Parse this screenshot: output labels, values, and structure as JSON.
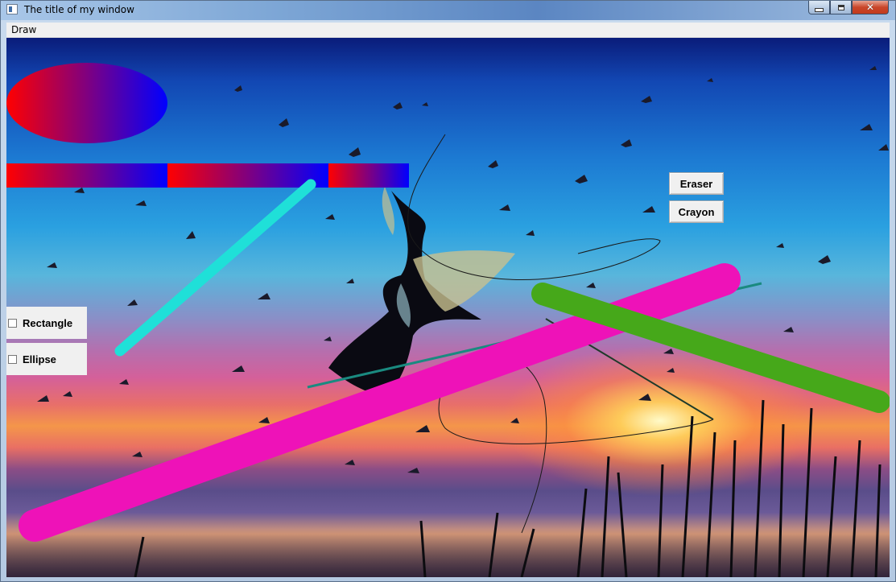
{
  "window": {
    "title": "The title of my window",
    "controls": {
      "minimize": "minimize",
      "maximize": "maximize",
      "close": "✕"
    }
  },
  "menu": {
    "items": [
      "Draw"
    ]
  },
  "toolbar": {
    "eraser_label": "Eraser",
    "crayon_label": "Crayon"
  },
  "shapes": {
    "rectangle_label": "Rectangle",
    "ellipse_label": "Ellipse",
    "rectangle_checked": false,
    "ellipse_checked": false
  },
  "colors": {
    "gradient_start": "#ff0000",
    "gradient_end": "#0000ff",
    "stroke_cyan": "#1fe0d8",
    "stroke_magenta": "#ee12b8",
    "stroke_green": "#46a81a",
    "stroke_teal": "#1a8a80",
    "stroke_black": "#1a1a1a"
  },
  "icons": {
    "app": "window-app-icon",
    "close": "close-icon",
    "minimize": "minimize-icon",
    "maximize": "maximize-icon"
  }
}
